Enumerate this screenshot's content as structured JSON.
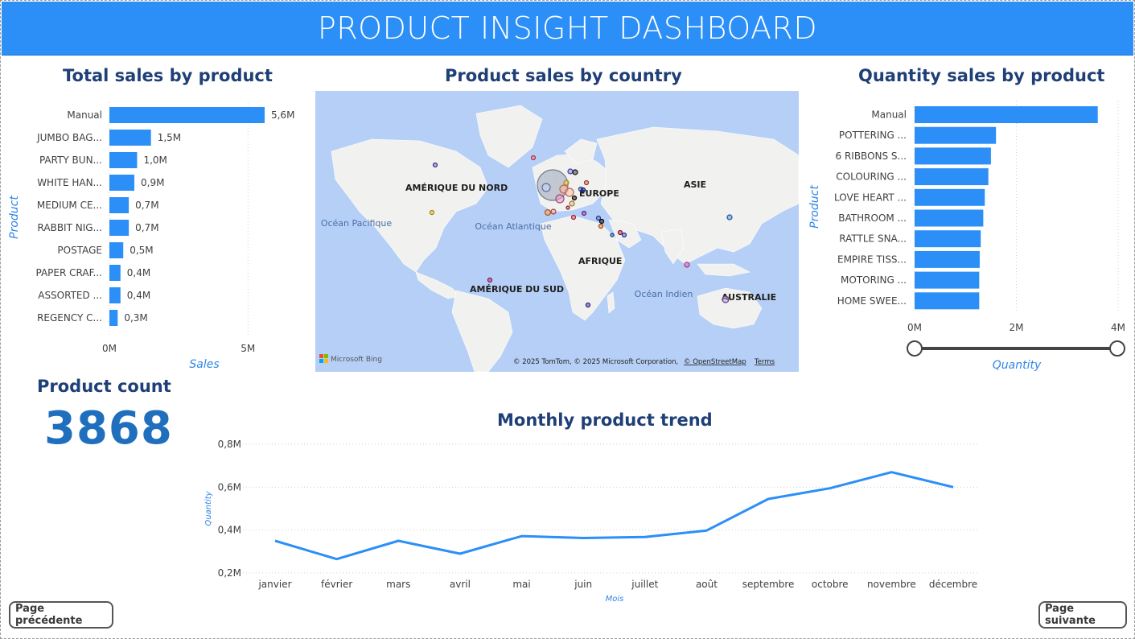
{
  "header": {
    "title": "PRODUCT INSIGHT DASHBOARD"
  },
  "colors": {
    "accent": "#2b8ff7",
    "bar": "#2b8ff7",
    "title": "#1f3f77",
    "kpi": "#1f6fbd",
    "map_bubble": "#9aa6b8"
  },
  "total_sales": {
    "title": "Total sales by product",
    "chart_data": {
      "type": "bar",
      "orientation": "horizontal",
      "categories": [
        "Manual",
        "JUMBO BAG...",
        "PARTY BUN...",
        "WHITE HAN...",
        "MEDIUM CE...",
        "RABBIT NIG...",
        "POSTAGE",
        "PAPER CRAF...",
        "ASSORTED ...",
        "REGENCY C..."
      ],
      "values": [
        5.6,
        1.5,
        1.0,
        0.9,
        0.7,
        0.7,
        0.5,
        0.4,
        0.4,
        0.3
      ],
      "value_labels": [
        "5,6M",
        "1,5M",
        "1,0M",
        "0,9M",
        "0,7M",
        "0,7M",
        "0,5M",
        "0,4M",
        "0,4M",
        "0,3M"
      ],
      "xlabel": "Sales",
      "ylabel": "Product",
      "xlim": [
        0,
        6.5
      ],
      "xticks": [
        0,
        5
      ],
      "xtick_labels": [
        "0M",
        "5M"
      ],
      "grid": true
    }
  },
  "map": {
    "title": "Product sales by country",
    "continents": [
      "AMÉRIQUE DU NORD",
      "EUROPE",
      "ASIE",
      "AFRIQUE",
      "AMÉRIQUE DU SUD",
      "AUSTRALIE"
    ],
    "oceans": [
      "Océan Pacifique",
      "Océan Atlantique",
      "Océan Indien"
    ],
    "brand": "Microsoft Bing",
    "attribution": "© 2025 TomTom, © 2025 Microsoft Corporation,",
    "osm": "© OpenStreetMap",
    "terms": "Terms"
  },
  "quantity_sales": {
    "title": "Quantity sales by product",
    "chart_data": {
      "type": "bar",
      "orientation": "horizontal",
      "categories": [
        "Manual",
        "POTTERING ...",
        "6 RIBBONS S...",
        "COLOURING ...",
        "LOVE HEART ...",
        "BATHROOM ...",
        "RATTLE SNA...",
        "EMPIRE TISS...",
        "MOTORING ...",
        "HOME SWEE..."
      ],
      "values": [
        3.6,
        1.6,
        1.5,
        1.45,
        1.38,
        1.35,
        1.3,
        1.28,
        1.27,
        1.27
      ],
      "xlabel": "Quantity",
      "ylabel": "Product",
      "xlim": [
        0,
        4
      ],
      "xticks": [
        0,
        2,
        4
      ],
      "xtick_labels": [
        "0M",
        "2M",
        "4M"
      ],
      "grid": true
    }
  },
  "kpi": {
    "title": "Product count",
    "value": "3868"
  },
  "trend": {
    "title": "Monthly product trend",
    "chart_data": {
      "type": "line",
      "x": [
        "janvier",
        "février",
        "mars",
        "avril",
        "mai",
        "juin",
        "juillet",
        "août",
        "septembre",
        "octobre",
        "novembre",
        "décembre"
      ],
      "values": [
        0.35,
        0.265,
        0.35,
        0.29,
        0.372,
        0.363,
        0.368,
        0.398,
        0.545,
        0.595,
        0.67,
        0.6
      ],
      "xlabel": "Mois",
      "ylabel": "Quantity",
      "ylim": [
        0.2,
        0.8
      ],
      "yticks": [
        0.2,
        0.4,
        0.6,
        0.8
      ],
      "ytick_labels": [
        "0,2M",
        "0,4M",
        "0,6M",
        "0,8M"
      ],
      "grid": true
    }
  },
  "nav": {
    "prev": "Page précédente",
    "next": "Page suivante"
  }
}
